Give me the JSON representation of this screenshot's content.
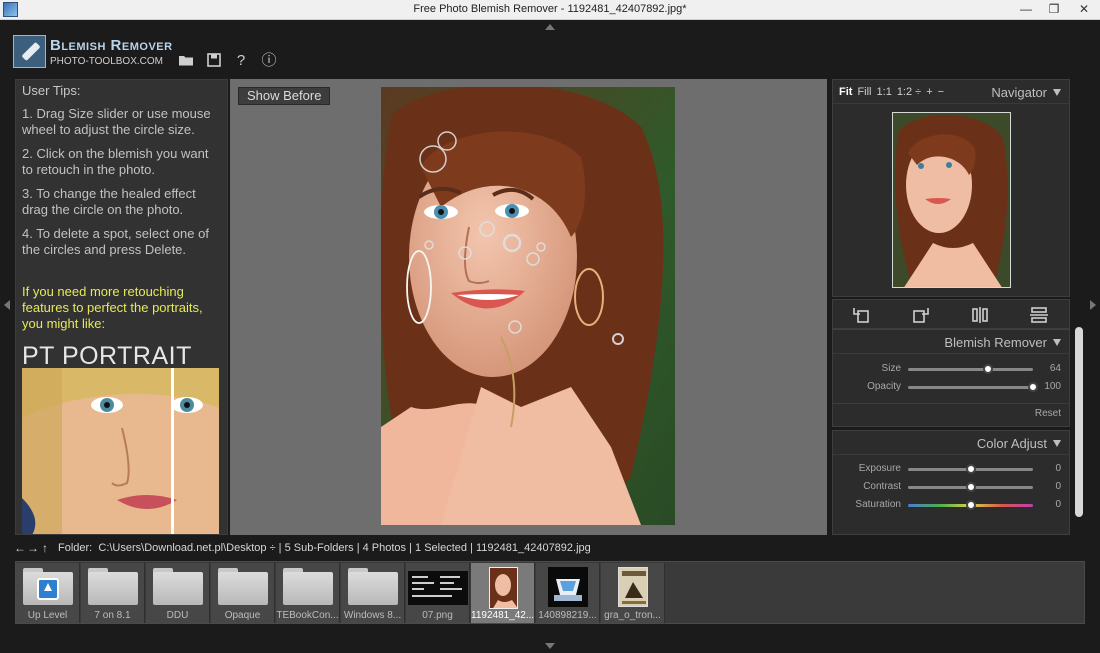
{
  "window": {
    "title": "Free Photo Blemish Remover - 1192481_42407892.jpg*",
    "minimize": "—",
    "maximize": "❐",
    "close": "✕"
  },
  "header": {
    "app_name": "Blemish Remover",
    "site": "PHOTO-TOOLBOX.COM",
    "icons": [
      "folder-icon",
      "save-icon",
      "help-icon",
      "info-icon"
    ],
    "help_glyph": "?",
    "info_glyph": "ⓘ"
  },
  "tips": {
    "heading": "User Tips:",
    "items": [
      "1. Drag Size slider or use mouse wheel to adjust the circle size.",
      "2. Click on the blemish you want to retouch in the photo.",
      "3. To change the healed effect drag the circle on the photo.",
      "4. To delete a spot, select one of the circles and press Delete."
    ],
    "promo": "If you need more retouching features to perfect the portraits, you might like:",
    "promo_title": "PT PORTRAIT"
  },
  "canvas": {
    "show_before": "Show Before"
  },
  "navigator": {
    "title": "Navigator",
    "zoom_options": [
      "Fit",
      "Fill",
      "1:1",
      "1:2 ÷",
      "+",
      "−"
    ],
    "selected_zoom": "Fit"
  },
  "tools": [
    "rotate-left-icon",
    "rotate-right-icon",
    "flip-horizontal-icon",
    "flip-vertical-icon"
  ],
  "blemish_remover": {
    "title": "Blemish Remover",
    "size_label": "Size",
    "size_value": "64",
    "size_fraction": 0.64,
    "opacity_label": "Opacity",
    "opacity_value": "100",
    "opacity_fraction": 1.0,
    "reset": "Reset"
  },
  "color_adjust": {
    "title": "Color Adjust",
    "exposure_label": "Exposure",
    "exposure_value": "0",
    "contrast_label": "Contrast",
    "contrast_value": "0",
    "saturation_label": "Saturation",
    "saturation_value": "0",
    "fraction": 0.5
  },
  "folder_bar": {
    "label": "Folder:",
    "path": "C:\\Users\\Download.net.pl\\Desktop ÷ | 5 Sub-Folders | 4 Photos | 1 Selected | 1192481_42407892.jpg",
    "back": "←",
    "forward": "→",
    "up": "↑"
  },
  "filmstrip": {
    "items": [
      {
        "label": "Up Level",
        "kind": "up"
      },
      {
        "label": "7 on 8.1",
        "kind": "folder"
      },
      {
        "label": "DDU",
        "kind": "folder"
      },
      {
        "label": "Opaque",
        "kind": "folder"
      },
      {
        "label": "TEBookCon...",
        "kind": "folder"
      },
      {
        "label": "Windows 8...",
        "kind": "folder"
      },
      {
        "label": "07.png",
        "kind": "image"
      },
      {
        "label": "1192481_42...",
        "kind": "image",
        "selected": true
      },
      {
        "label": "140898219...",
        "kind": "image"
      },
      {
        "label": "gra_o_tron...",
        "kind": "image"
      }
    ]
  }
}
